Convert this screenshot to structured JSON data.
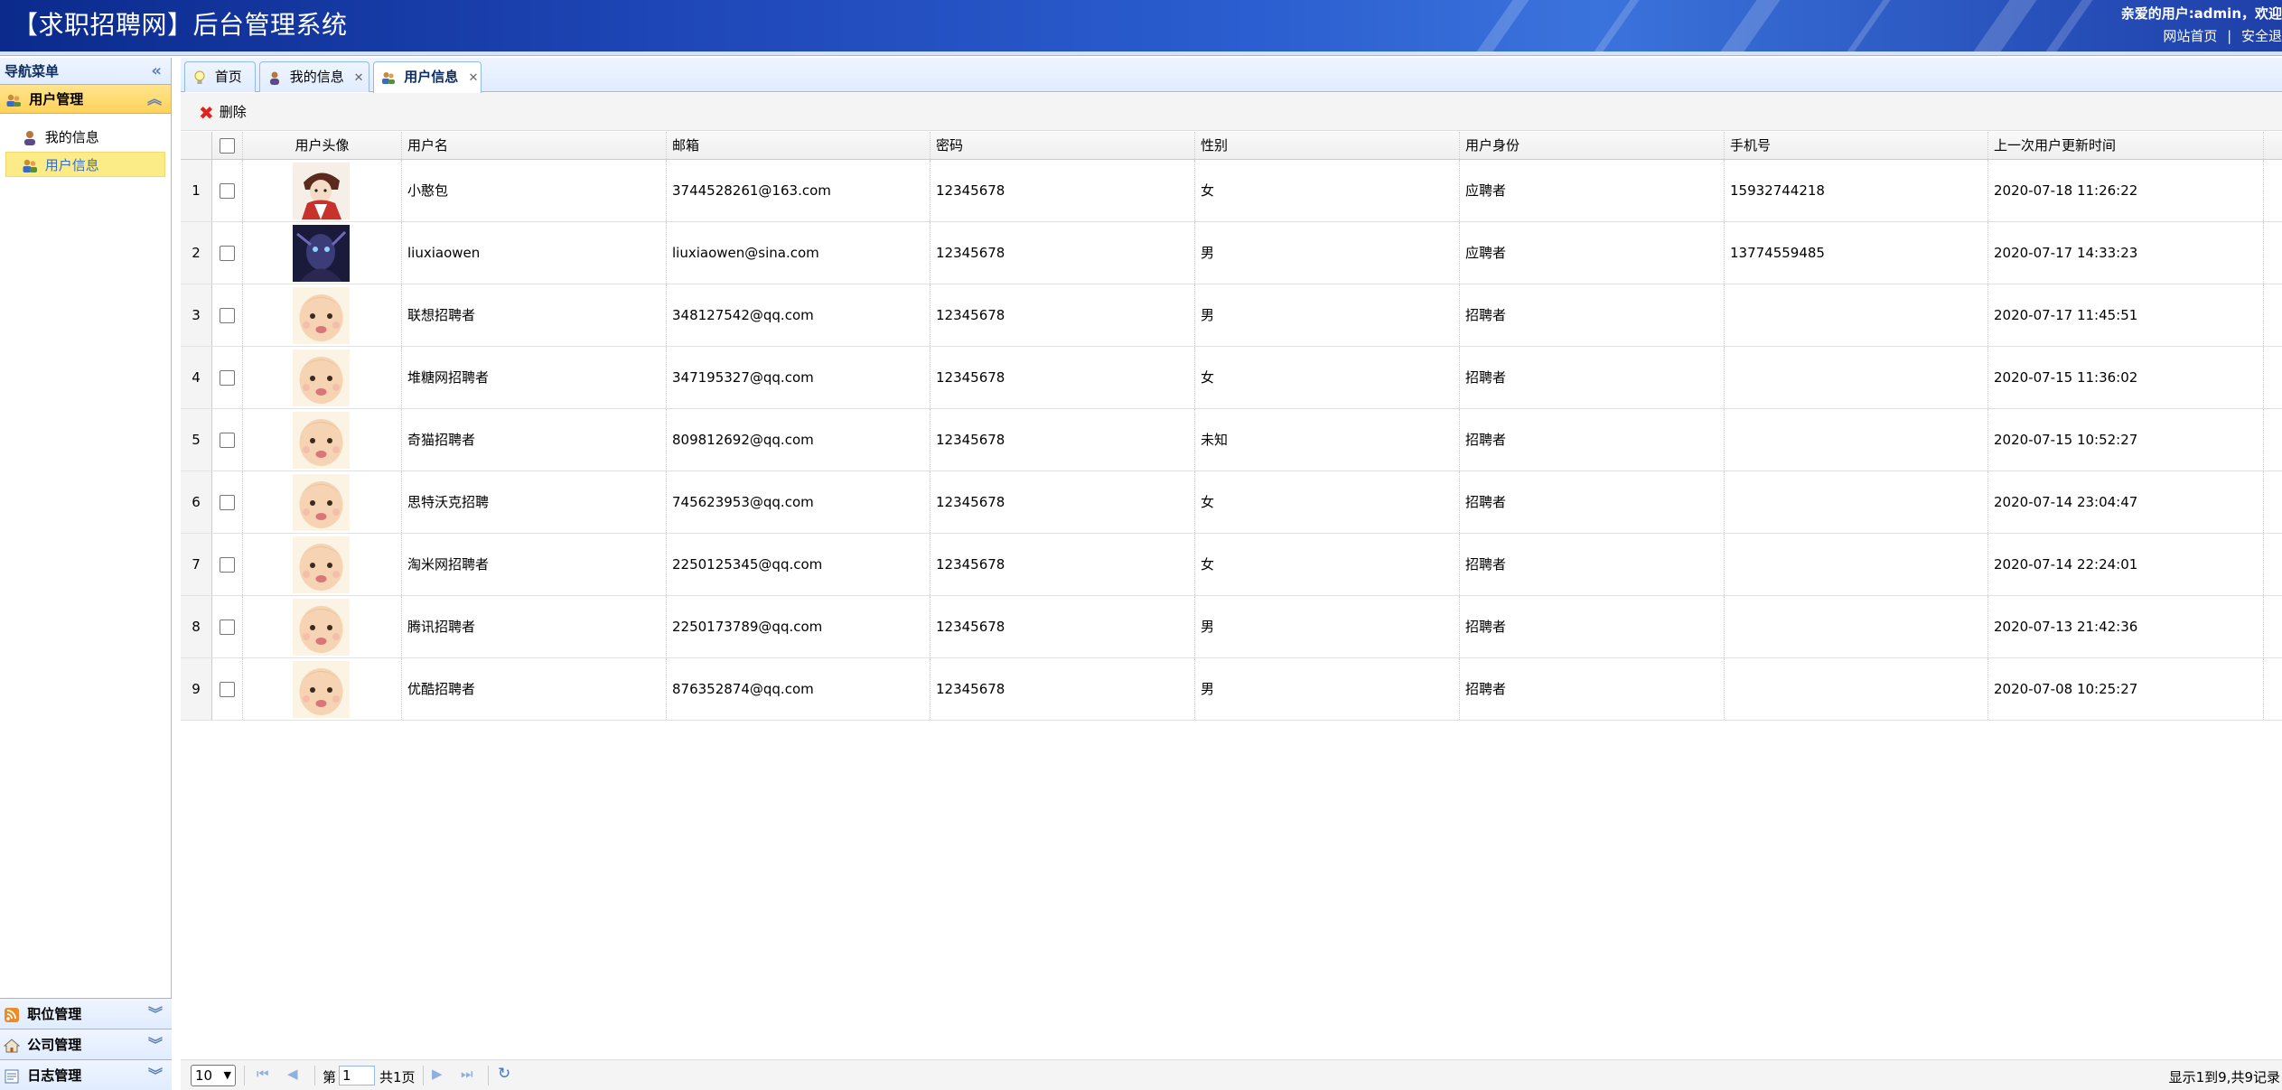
{
  "header": {
    "title": "【求职招聘网】后台管理系统",
    "welcome": "亲爱的用户:admin，欢迎",
    "link_home": "网站首页",
    "separator": "|",
    "link_safe": "安全退"
  },
  "sidebar": {
    "title": "导航菜单",
    "active_group": "用户管理",
    "items": [
      {
        "label": "我的信息",
        "icon": "user-icon"
      },
      {
        "label": "用户信息",
        "icon": "users-icon"
      }
    ],
    "collapsed_groups": [
      {
        "label": "职位管理",
        "icon": "rss-icon"
      },
      {
        "label": "公司管理",
        "icon": "home-icon"
      },
      {
        "label": "日志管理",
        "icon": "log-icon"
      }
    ]
  },
  "tabs": [
    {
      "label": "首页",
      "icon": "lightbulb-icon",
      "closable": false
    },
    {
      "label": "我的信息",
      "icon": "user-icon",
      "closable": true
    },
    {
      "label": "用户信息",
      "icon": "users-icon",
      "closable": true
    }
  ],
  "toolbar": {
    "delete_label": "删除"
  },
  "grid": {
    "columns": [
      "用户头像",
      "用户名",
      "邮箱",
      "密码",
      "性别",
      "用户身份",
      "手机号",
      "上一次用户更新时间"
    ],
    "rows": [
      {
        "num": "1",
        "avatar": "anime",
        "username": "小憨包",
        "email": "3744528261@163.com",
        "password": "12345678",
        "gender": "女",
        "role": "应聘者",
        "phone": "15932744218",
        "updated": "2020-07-18 11:26:22"
      },
      {
        "num": "2",
        "avatar": "dark",
        "username": "liuxiaowen",
        "email": "liuxiaowen@sina.com",
        "password": "12345678",
        "gender": "男",
        "role": "应聘者",
        "phone": "13774559485",
        "updated": "2020-07-17 14:33:23"
      },
      {
        "num": "3",
        "avatar": "baby",
        "username": "联想招聘者",
        "email": "348127542@qq.com",
        "password": "12345678",
        "gender": "男",
        "role": "招聘者",
        "phone": "",
        "updated": "2020-07-17 11:45:51"
      },
      {
        "num": "4",
        "avatar": "baby",
        "username": "堆糖网招聘者",
        "email": "347195327@qq.com",
        "password": "12345678",
        "gender": "女",
        "role": "招聘者",
        "phone": "",
        "updated": "2020-07-15 11:36:02"
      },
      {
        "num": "5",
        "avatar": "baby",
        "username": "奇猫招聘者",
        "email": "809812692@qq.com",
        "password": "12345678",
        "gender": "未知",
        "role": "招聘者",
        "phone": "",
        "updated": "2020-07-15 10:52:27"
      },
      {
        "num": "6",
        "avatar": "baby",
        "username": "思特沃克招聘",
        "email": "745623953@qq.com",
        "password": "12345678",
        "gender": "女",
        "role": "招聘者",
        "phone": "",
        "updated": "2020-07-14 23:04:47"
      },
      {
        "num": "7",
        "avatar": "baby",
        "username": "淘米网招聘者",
        "email": "2250125345@qq.com",
        "password": "12345678",
        "gender": "女",
        "role": "招聘者",
        "phone": "",
        "updated": "2020-07-14 22:24:01"
      },
      {
        "num": "8",
        "avatar": "baby",
        "username": "腾讯招聘者",
        "email": "2250173789@qq.com",
        "password": "12345678",
        "gender": "男",
        "role": "招聘者",
        "phone": "",
        "updated": "2020-07-13 21:42:36"
      },
      {
        "num": "9",
        "avatar": "baby",
        "username": "优酷招聘者",
        "email": "876352874@qq.com",
        "password": "12345678",
        "gender": "男",
        "role": "招聘者",
        "phone": "",
        "updated": "2020-07-08 10:25:27"
      }
    ]
  },
  "pager": {
    "page_size": "10",
    "page_prefix": "第",
    "page_current": "1",
    "page_suffix": "共1页",
    "info": "显示1到9,共9记录"
  }
}
